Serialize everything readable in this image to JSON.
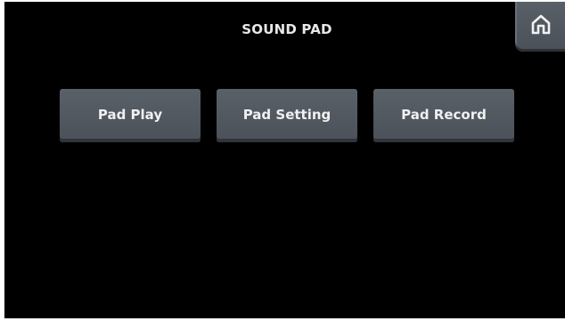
{
  "header": {
    "title": "SOUND PAD",
    "home_icon": "home-icon"
  },
  "main": {
    "buttons": [
      {
        "label": "Pad Play"
      },
      {
        "label": "Pad Setting"
      },
      {
        "label": "Pad Record"
      }
    ]
  },
  "colors": {
    "background": "#000000",
    "button": "#53595f",
    "text": "#f0f0f0"
  }
}
